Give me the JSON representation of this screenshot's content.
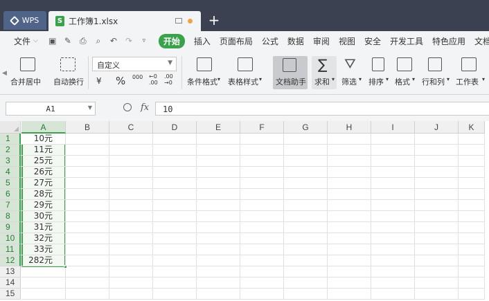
{
  "tabs": {
    "app": "WPS",
    "document": "工作簿1.xlsx",
    "new_tab": "+"
  },
  "menu": {
    "file": "文件",
    "file_caret": "⌵",
    "start": "开始",
    "items": [
      "插入",
      "页面布局",
      "公式",
      "数据",
      "审阅",
      "视图",
      "安全",
      "开发工具",
      "特色应用",
      "文档助"
    ]
  },
  "ribbon": {
    "merge": "合并居中",
    "wrap": "自动换行",
    "number_format": "自定义",
    "currency_symbol": "¥",
    "percent_symbol": "%",
    "thousands": "000",
    "dec_increase": "←0\n.00",
    "dec_decrease": ".00\n→0",
    "conditional_format": "条件格式",
    "table_style": "表格样式",
    "doc_helper": "文档助手",
    "sum": "求和",
    "filter": "筛选",
    "sort": "排序",
    "format": "格式",
    "rows_cols": "行和列",
    "worksheet": "工作表"
  },
  "formula_bar": {
    "name_box": "A1",
    "fx": "fx",
    "value": "10"
  },
  "grid": {
    "columns": [
      "A",
      "B",
      "C",
      "D",
      "E",
      "F",
      "G",
      "H",
      "I",
      "J",
      "K"
    ],
    "rows": [
      "1",
      "2",
      "3",
      "4",
      "5",
      "6",
      "7",
      "8",
      "9",
      "10",
      "11",
      "12",
      "13",
      "14",
      "15"
    ],
    "column_a_values": [
      "10元",
      "11元",
      "25元",
      "26元",
      "27元",
      "28元",
      "29元",
      "30元",
      "31元",
      "32元",
      "33元",
      "282元"
    ]
  },
  "colors": {
    "accent": "#3aa24a",
    "titlebar": "#3b4150",
    "ribbon_bg": "#f3f4f6"
  }
}
